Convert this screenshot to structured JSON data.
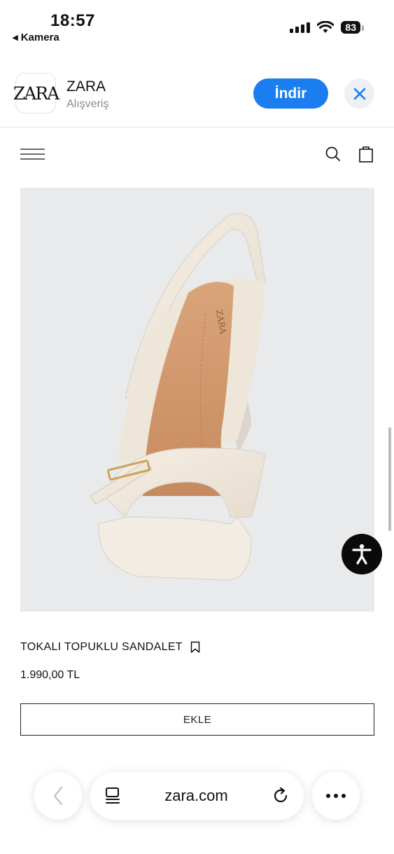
{
  "status_bar": {
    "time": "18:57",
    "back_label": "◂ Kamera",
    "battery": "83"
  },
  "app_banner": {
    "logo_text": "ZARA",
    "app_name": "ZARA",
    "category": "Alışveriş",
    "get_label": "İndir"
  },
  "product": {
    "name": "TOKALI TOPUKLU SANDALET",
    "price": "1.990,00 TL",
    "add_label": "EKLE"
  },
  "browser": {
    "url": "zara.com"
  },
  "colors": {
    "accent": "#1a7df0",
    "photo_bg": "#e9eaec",
    "text": "#111111"
  }
}
